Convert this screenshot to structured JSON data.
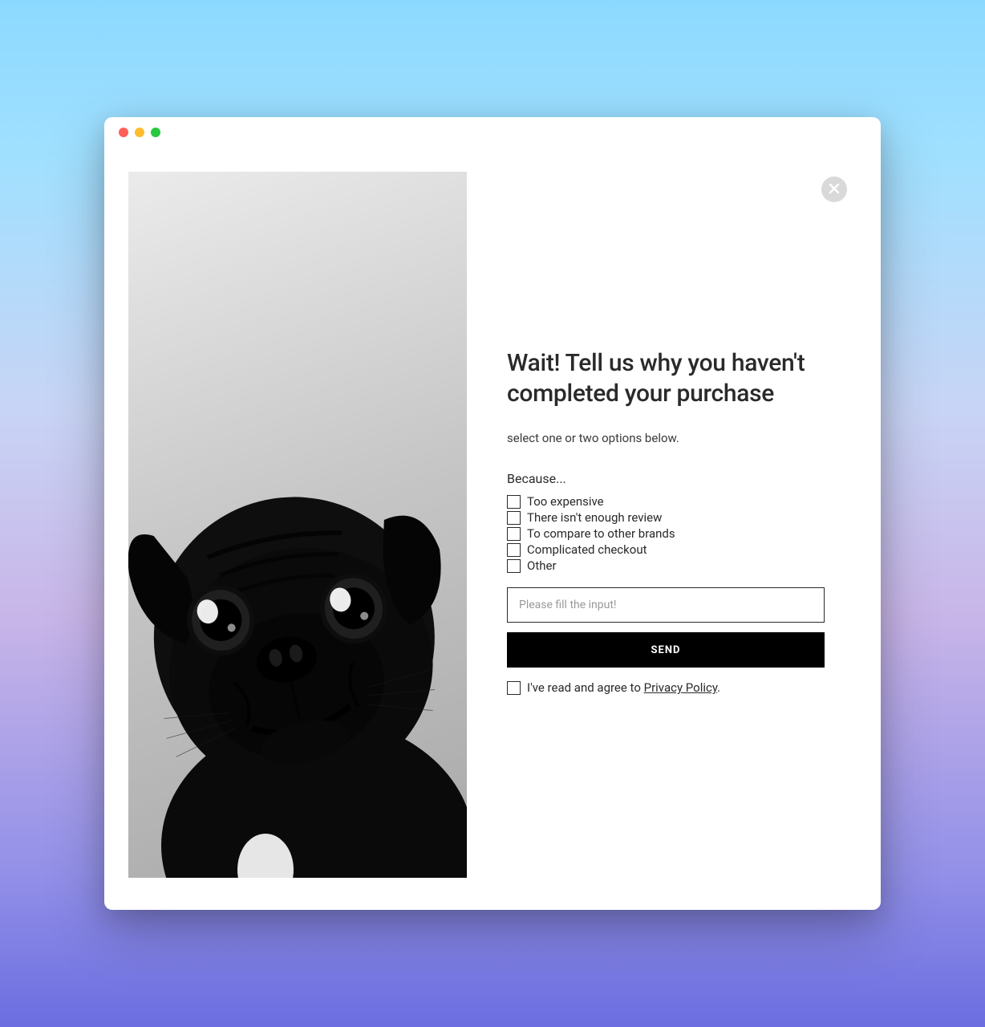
{
  "modal": {
    "heading": "Wait! Tell us why you haven't completed your purchase",
    "subtitle": "select one or two options below.",
    "options_label": "Because...",
    "options": [
      "Too expensive",
      "There isn't enough review",
      "To compare to other brands",
      "Complicated checkout",
      "Other"
    ],
    "input_placeholder": "Please fill the input!",
    "submit_label": "SEND",
    "consent_prefix": "I've read and agree to ",
    "consent_link": "Privacy Policy",
    "consent_suffix": "."
  }
}
